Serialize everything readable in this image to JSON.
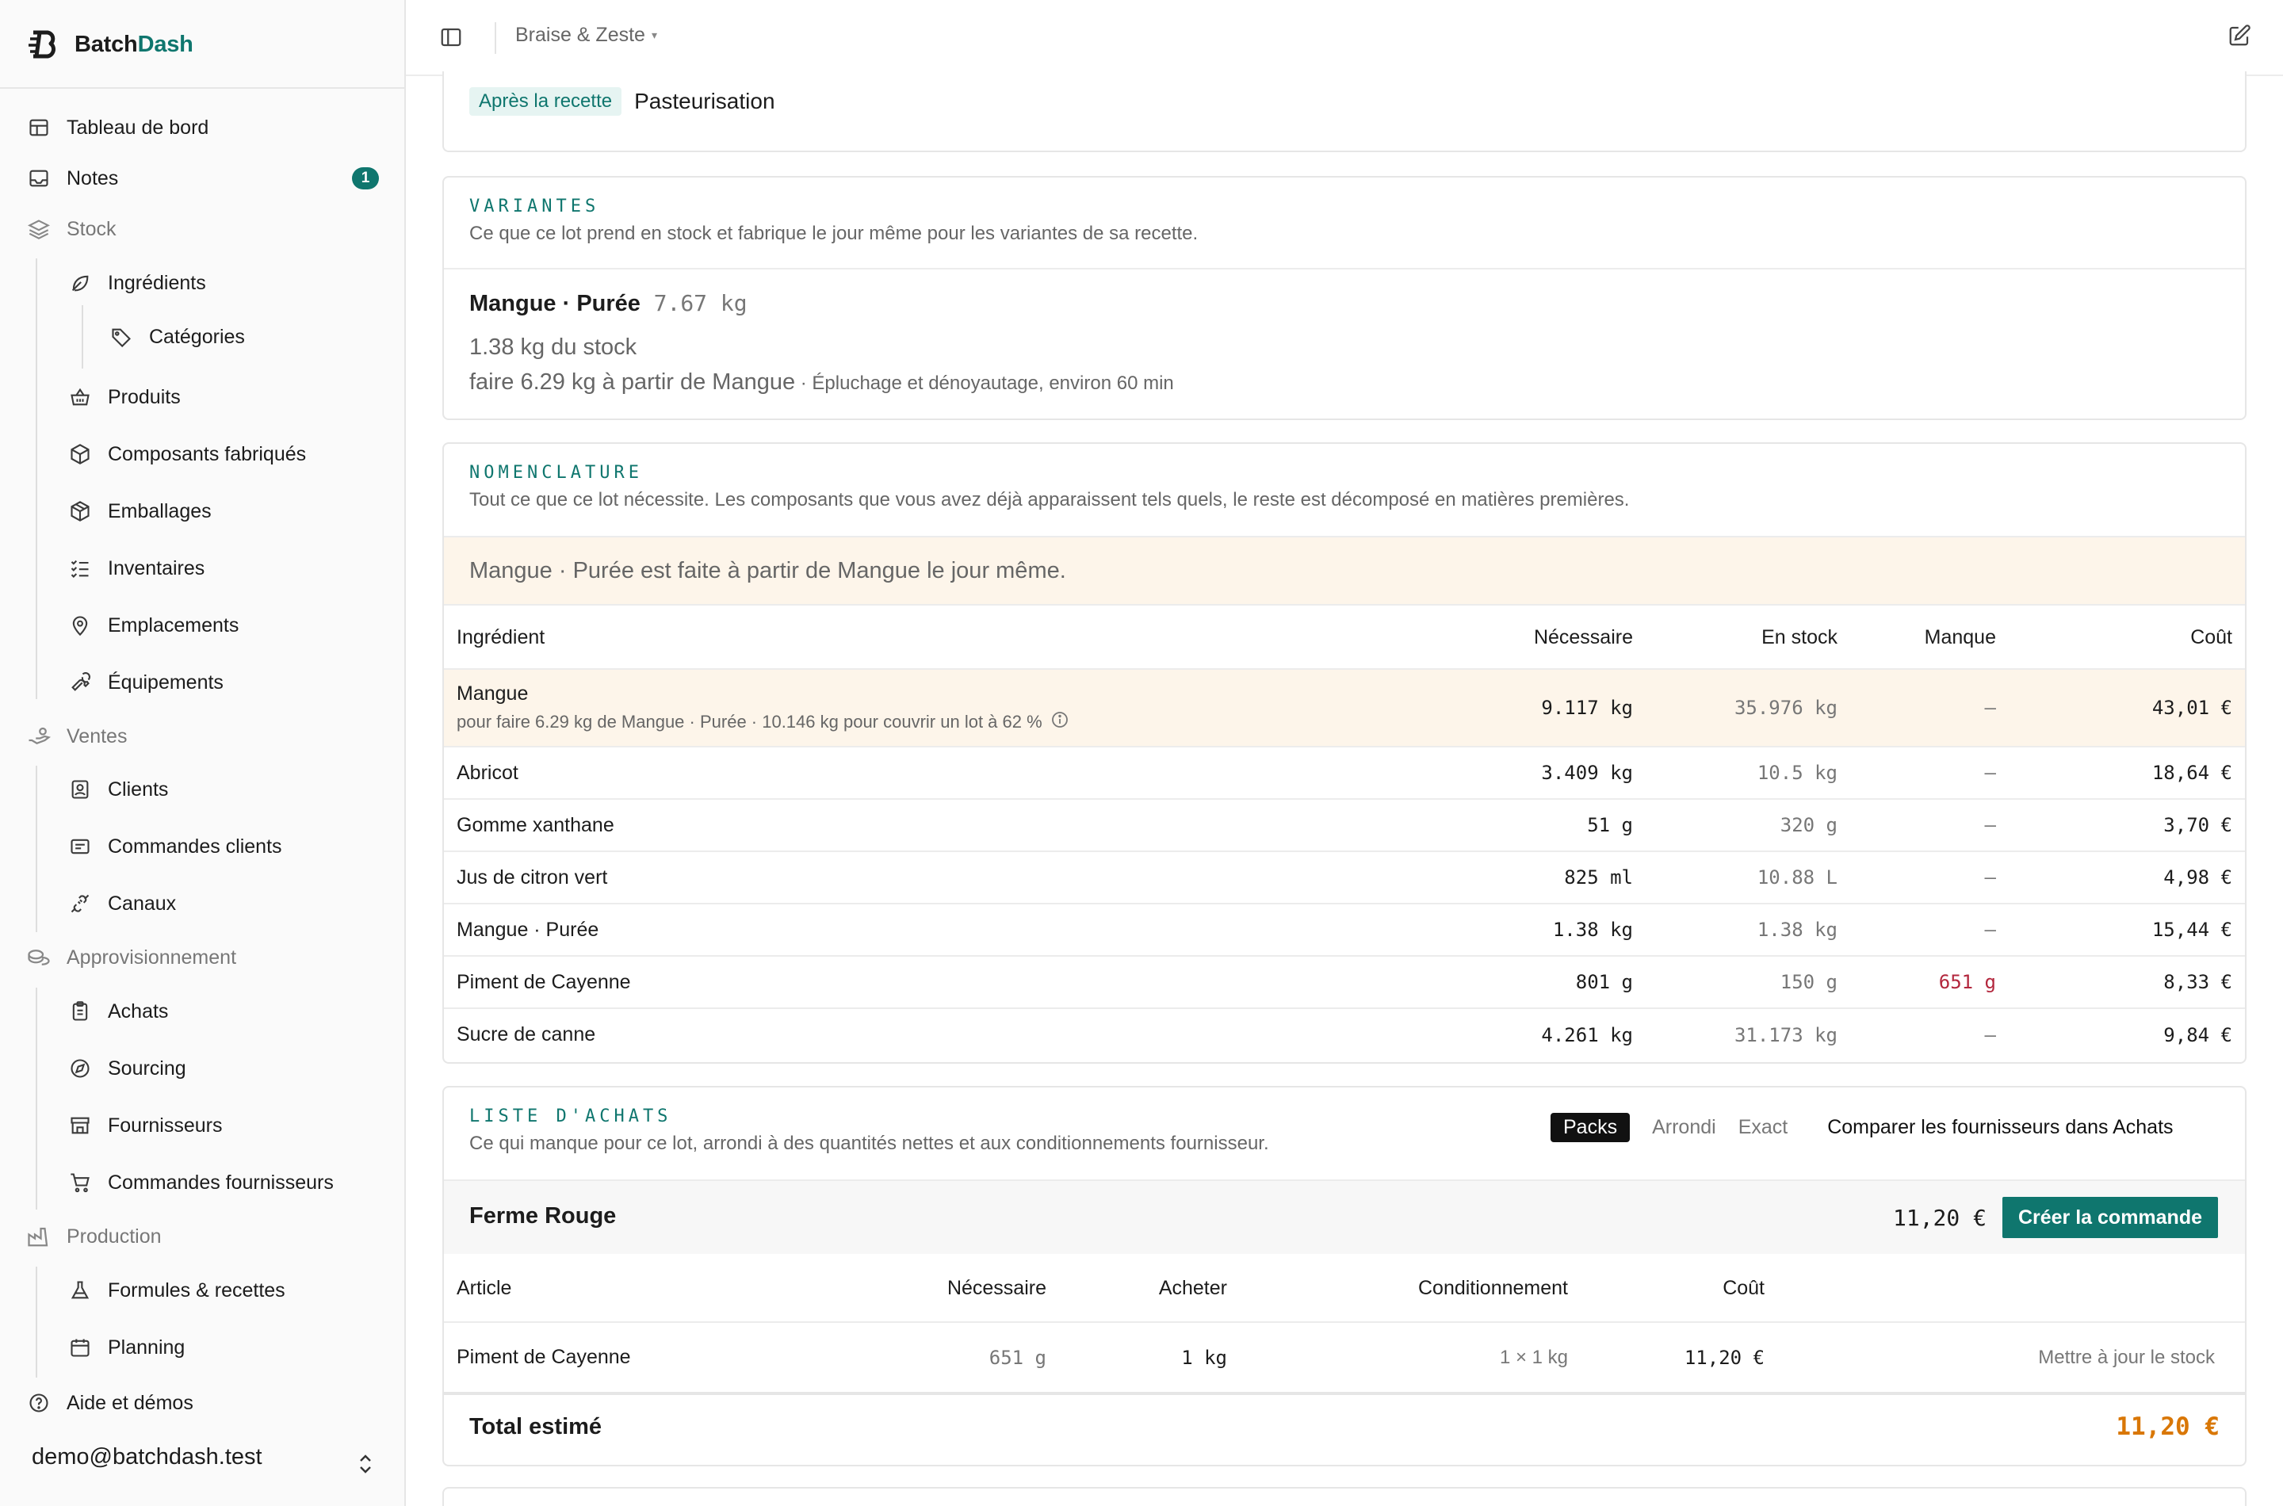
{
  "brand": {
    "name_part1": "Batch",
    "name_part2": "Dash"
  },
  "sidebar": {
    "items": [
      {
        "label": "Tableau de bord",
        "icon": "layout-icon"
      },
      {
        "label": "Notes",
        "icon": "inbox-icon",
        "badge": "1"
      },
      {
        "label": "Stock",
        "icon": "layers-icon"
      },
      {
        "label": "Ingrédients",
        "icon": "leaf-icon"
      },
      {
        "label": "Catégories",
        "icon": "tag-icon"
      },
      {
        "label": "Produits",
        "icon": "basket-icon"
      },
      {
        "label": "Composants fabriqués",
        "icon": "box-icon"
      },
      {
        "label": "Emballages",
        "icon": "package-icon"
      },
      {
        "label": "Inventaires",
        "icon": "checklist-icon"
      },
      {
        "label": "Emplacements",
        "icon": "map-pin-icon"
      },
      {
        "label": "Équipements",
        "icon": "wrench-icon"
      },
      {
        "label": "Ventes",
        "icon": "hand-coins-icon"
      },
      {
        "label": "Clients",
        "icon": "contact-icon"
      },
      {
        "label": "Commandes clients",
        "icon": "receipt-icon"
      },
      {
        "label": "Canaux",
        "icon": "plug-icon"
      },
      {
        "label": "Approvisionnement",
        "icon": "coins-icon"
      },
      {
        "label": "Achats",
        "icon": "clipboard-icon"
      },
      {
        "label": "Sourcing",
        "icon": "compass-icon"
      },
      {
        "label": "Fournisseurs",
        "icon": "store-icon"
      },
      {
        "label": "Commandes fournisseurs",
        "icon": "cart-icon"
      },
      {
        "label": "Production",
        "icon": "factory-icon"
      },
      {
        "label": "Formules & recettes",
        "icon": "flask-icon"
      },
      {
        "label": "Planning",
        "icon": "calendar-icon"
      },
      {
        "label": "Aide et démos",
        "icon": "help-icon"
      }
    ],
    "user_email": "demo@batchdash.test"
  },
  "topbar": {
    "org": "Braise & Zeste"
  },
  "after_recipe": {
    "tag": "Après la recette",
    "step": "Pasteurisation"
  },
  "variantes": {
    "title": "VARIANTES",
    "desc": "Ce que ce lot prend en stock et fabrique le jour même pour les variantes de sa recette.",
    "item_name": "Mangue · Purée",
    "item_qty": "7.67 kg",
    "from_stock": "1.38 kg du stock",
    "make_line": "faire 6.29 kg à partir de Mangue",
    "make_note": "· Épluchage et dénoyautage, environ 60 min"
  },
  "nomenclature": {
    "title": "NOMENCLATURE",
    "desc": "Tout ce que ce lot nécessite. Les composants que vous avez déjà apparaissent tels quels, le reste est décomposé en matières premières.",
    "notice": "Mangue · Purée est faite à partir de Mangue le jour même.",
    "columns": [
      "Ingrédient",
      "Nécessaire",
      "En stock",
      "Manque",
      "Coût"
    ],
    "rows": [
      {
        "name": "Mangue",
        "sub": "pour faire 6.29 kg de Mangue · Purée · 10.146 kg pour couvrir un lot à 62 %",
        "needed": "9.117 kg",
        "stock": "35.976 kg",
        "missing": "–",
        "cost": "43,01 €"
      },
      {
        "name": "Abricot",
        "needed": "3.409 kg",
        "stock": "10.5 kg",
        "missing": "–",
        "cost": "18,64 €"
      },
      {
        "name": "Gomme xanthane",
        "needed": "51 g",
        "stock": "320 g",
        "missing": "–",
        "cost": "3,70 €"
      },
      {
        "name": "Jus de citron vert",
        "needed": "825 ml",
        "stock": "10.88 L",
        "missing": "–",
        "cost": "4,98 €"
      },
      {
        "name": "Mangue · Purée",
        "needed": "1.38 kg",
        "stock": "1.38 kg",
        "missing": "–",
        "cost": "15,44 €"
      },
      {
        "name": "Piment de Cayenne",
        "needed": "801 g",
        "stock": "150 g",
        "missing": "651 g",
        "cost": "8,33 €"
      },
      {
        "name": "Sucre de canne",
        "needed": "4.261 kg",
        "stock": "31.173 kg",
        "missing": "–",
        "cost": "9,84 €"
      }
    ]
  },
  "liste_achats": {
    "title": "LISTE D'ACHATS",
    "desc": "Ce qui manque pour ce lot, arrondi à des quantités nettes et aux conditionnements fournisseur.",
    "modes": [
      "Packs",
      "Arrondi",
      "Exact"
    ],
    "compare_link": "Comparer les fournisseurs dans Achats",
    "supplier": {
      "name": "Ferme Rouge",
      "total": "11,20 €",
      "create_btn": "Créer la commande"
    },
    "columns": [
      "Article",
      "Nécessaire",
      "Acheter",
      "Conditionnement",
      "Coût"
    ],
    "rows": [
      {
        "name": "Piment de Cayenne",
        "needed": "651 g",
        "buy": "1 kg",
        "pack": "1 × 1 kg",
        "cost": "11,20 €",
        "action": "Mettre à jour le stock"
      }
    ],
    "total_label": "Total estimé",
    "total_value": "11,20 €"
  }
}
